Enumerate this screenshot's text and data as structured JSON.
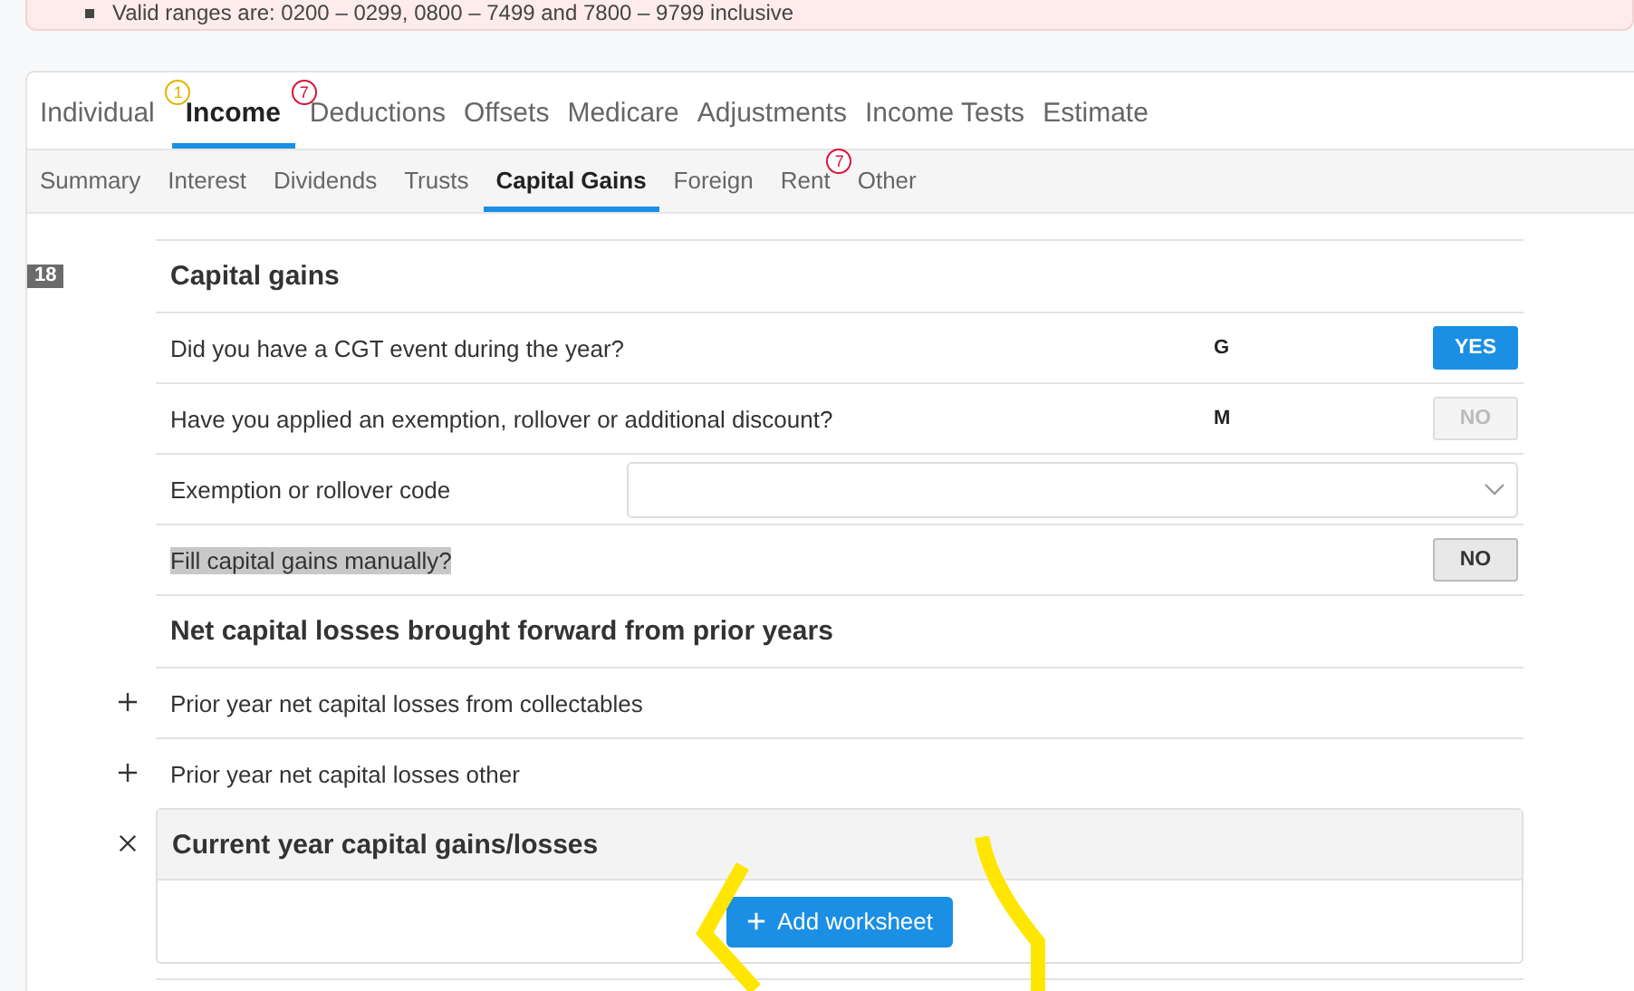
{
  "alert": {
    "items": [
      "Valid ranges are: 0200 – 0299, 0800 – 7499 and 7800 – 9799 inclusive"
    ]
  },
  "tabs": [
    {
      "label": "Individual",
      "selected": false,
      "badge": "1",
      "color": "#e0b500"
    },
    {
      "label": "Income",
      "selected": true,
      "badge": "7",
      "color": "#d6163a"
    },
    {
      "label": "Deductions",
      "selected": false
    },
    {
      "label": "Offsets",
      "selected": false
    },
    {
      "label": "Medicare",
      "selected": false
    },
    {
      "label": "Adjustments",
      "selected": false
    },
    {
      "label": "Income Tests",
      "selected": false
    },
    {
      "label": "Estimate",
      "selected": false
    }
  ],
  "subtabs": [
    {
      "label": "Summary",
      "selected": false
    },
    {
      "label": "Interest",
      "selected": false
    },
    {
      "label": "Dividends",
      "selected": false
    },
    {
      "label": "Trusts",
      "selected": false
    },
    {
      "label": "Capital Gains",
      "selected": true
    },
    {
      "label": "Foreign",
      "selected": false
    },
    {
      "label": "Rent",
      "selected": false,
      "badge": "7",
      "color": "#d6163a"
    },
    {
      "label": "Other",
      "selected": false
    }
  ],
  "section_number": "18",
  "rows": [
    {
      "kind": "heading",
      "label": "Capital gains"
    },
    {
      "kind": "toggle",
      "label": "Did you have a CGT event during the year?",
      "highlighted": false,
      "code": "G",
      "answer": {
        "label": "YES",
        "selected": true,
        "disabled": false
      }
    },
    {
      "kind": "toggle",
      "label": "Have you applied an exemption, rollover or additional discount?",
      "highlighted": false,
      "code": "M",
      "answer": {
        "label": "NO",
        "selected": false,
        "disabled": true
      }
    },
    {
      "kind": "select",
      "label": "Exemption or rollover code"
    },
    {
      "kind": "toggle",
      "label": "Fill capital gains manually?",
      "highlighted": true,
      "answer": {
        "label": "NO",
        "selected": false,
        "disabled": false
      }
    },
    {
      "kind": "heading",
      "label": "Net capital losses brought forward from prior years"
    },
    {
      "kind": "expander",
      "label": "Prior year net capital losses from collectables",
      "expanded": false
    },
    {
      "kind": "expander",
      "label": "Prior year net capital losses other",
      "expanded": false
    },
    {
      "kind": "panel",
      "label": "Current year capital gains/losses",
      "expanded": true,
      "button": "Add worksheet"
    }
  ]
}
